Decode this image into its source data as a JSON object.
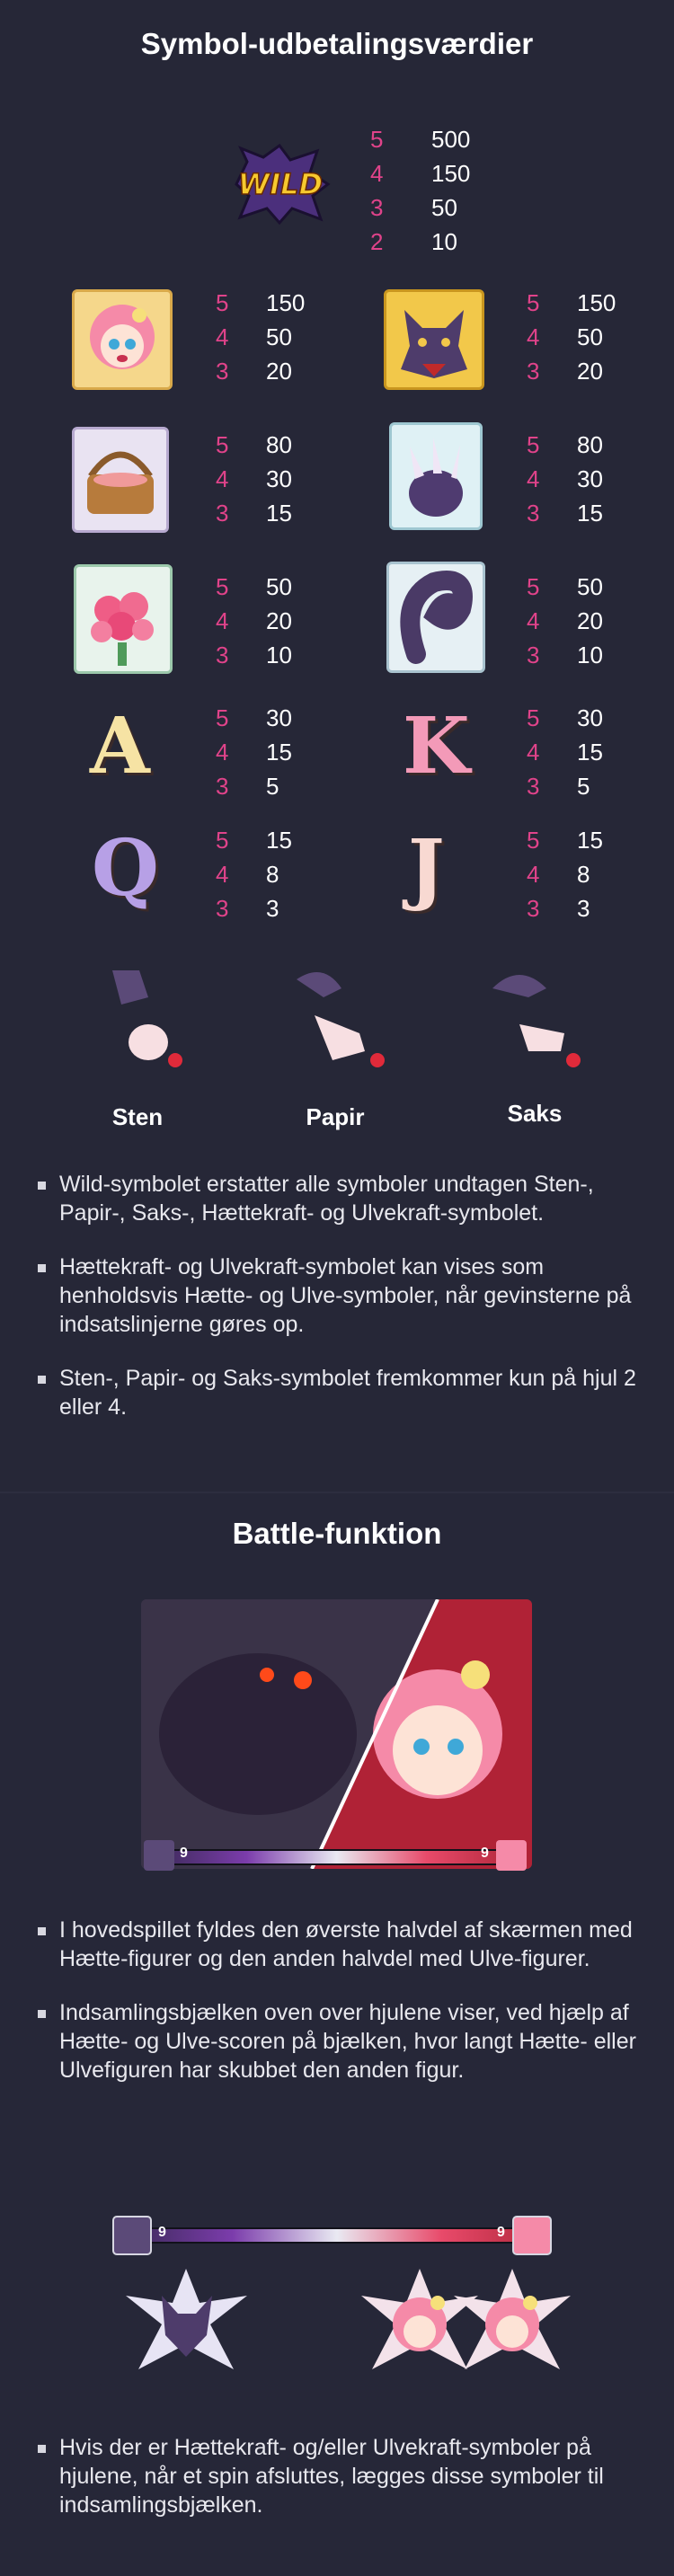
{
  "section1": {
    "title": "Symbol-udbetalingsværdier",
    "wild": {
      "label": "WILD",
      "pays": [
        {
          "count": "5",
          "value": "500"
        },
        {
          "count": "4",
          "value": "150"
        },
        {
          "count": "3",
          "value": "50"
        },
        {
          "count": "2",
          "value": "10"
        }
      ]
    },
    "symbols": [
      {
        "name": "hood-girl-icon",
        "pays": [
          {
            "count": "5",
            "value": "150"
          },
          {
            "count": "4",
            "value": "50"
          },
          {
            "count": "3",
            "value": "20"
          }
        ]
      },
      {
        "name": "wolf-icon",
        "pays": [
          {
            "count": "5",
            "value": "150"
          },
          {
            "count": "4",
            "value": "50"
          },
          {
            "count": "3",
            "value": "20"
          }
        ]
      },
      {
        "name": "basket-icon",
        "pays": [
          {
            "count": "5",
            "value": "80"
          },
          {
            "count": "4",
            "value": "30"
          },
          {
            "count": "3",
            "value": "15"
          }
        ]
      },
      {
        "name": "wolf-claw-icon",
        "pays": [
          {
            "count": "5",
            "value": "80"
          },
          {
            "count": "4",
            "value": "30"
          },
          {
            "count": "3",
            "value": "15"
          }
        ]
      },
      {
        "name": "roses-icon",
        "pays": [
          {
            "count": "5",
            "value": "50"
          },
          {
            "count": "4",
            "value": "20"
          },
          {
            "count": "3",
            "value": "10"
          }
        ]
      },
      {
        "name": "wolf-tail-icon",
        "pays": [
          {
            "count": "5",
            "value": "50"
          },
          {
            "count": "4",
            "value": "20"
          },
          {
            "count": "3",
            "value": "10"
          }
        ]
      },
      {
        "name": "letter-a-icon",
        "letter": "A",
        "pays": [
          {
            "count": "5",
            "value": "30"
          },
          {
            "count": "4",
            "value": "15"
          },
          {
            "count": "3",
            "value": "5"
          }
        ]
      },
      {
        "name": "letter-k-icon",
        "letter": "K",
        "pays": [
          {
            "count": "5",
            "value": "30"
          },
          {
            "count": "4",
            "value": "15"
          },
          {
            "count": "3",
            "value": "5"
          }
        ]
      },
      {
        "name": "letter-q-icon",
        "letter": "Q",
        "pays": [
          {
            "count": "5",
            "value": "15"
          },
          {
            "count": "4",
            "value": "8"
          },
          {
            "count": "3",
            "value": "3"
          }
        ]
      },
      {
        "name": "letter-j-icon",
        "letter": "J",
        "pays": [
          {
            "count": "5",
            "value": "15"
          },
          {
            "count": "4",
            "value": "8"
          },
          {
            "count": "3",
            "value": "3"
          }
        ]
      }
    ],
    "rps": [
      {
        "label": "Sten"
      },
      {
        "label": "Papir"
      },
      {
        "label": "Saks"
      }
    ],
    "bullets": [
      "Wild-symbolet erstatter alle symboler undtagen Sten-, Papir-, Saks-, Hættekraft- og Ulvekraft-symbolet.",
      "Hættekraft- og Ulvekraft-symbolet kan vises som henholdsvis Hætte- og Ulve-symboler, når gevinsterne på indsatslinjerne gøres op.",
      "Sten-, Papir- og Saks-symbolet fremkommer kun på hjul 2 eller 4."
    ]
  },
  "section2": {
    "title": "Battle-funktion",
    "battle_bar": {
      "left_score": "9",
      "right_score": "9"
    },
    "bullets": [
      "I hovedspillet fyldes den øverste halvdel af skærmen med Hætte-figurer og den anden halvdel med Ulve-figurer.",
      "Indsamlingsbjælken oven over hjulene viser, ved hjælp af Hætte- og Ulve-scoren på bjælken, hvor langt Hætte- eller Ulvefiguren har skubbet den anden figur.",
      "Hvis der er Hættekraft- og/eller Ulvekraft-symboler på hjulene, når et spin afsluttes, lægges disse symboler til indsamlingsbjælken."
    ],
    "collect_bar": {
      "left_score": "9",
      "right_score": "9"
    }
  },
  "colors": {
    "background": "#262737",
    "multiplier": "#e0438a",
    "accent_pink": "#f48ab0",
    "wolf_purple": "#5b4a78"
  }
}
